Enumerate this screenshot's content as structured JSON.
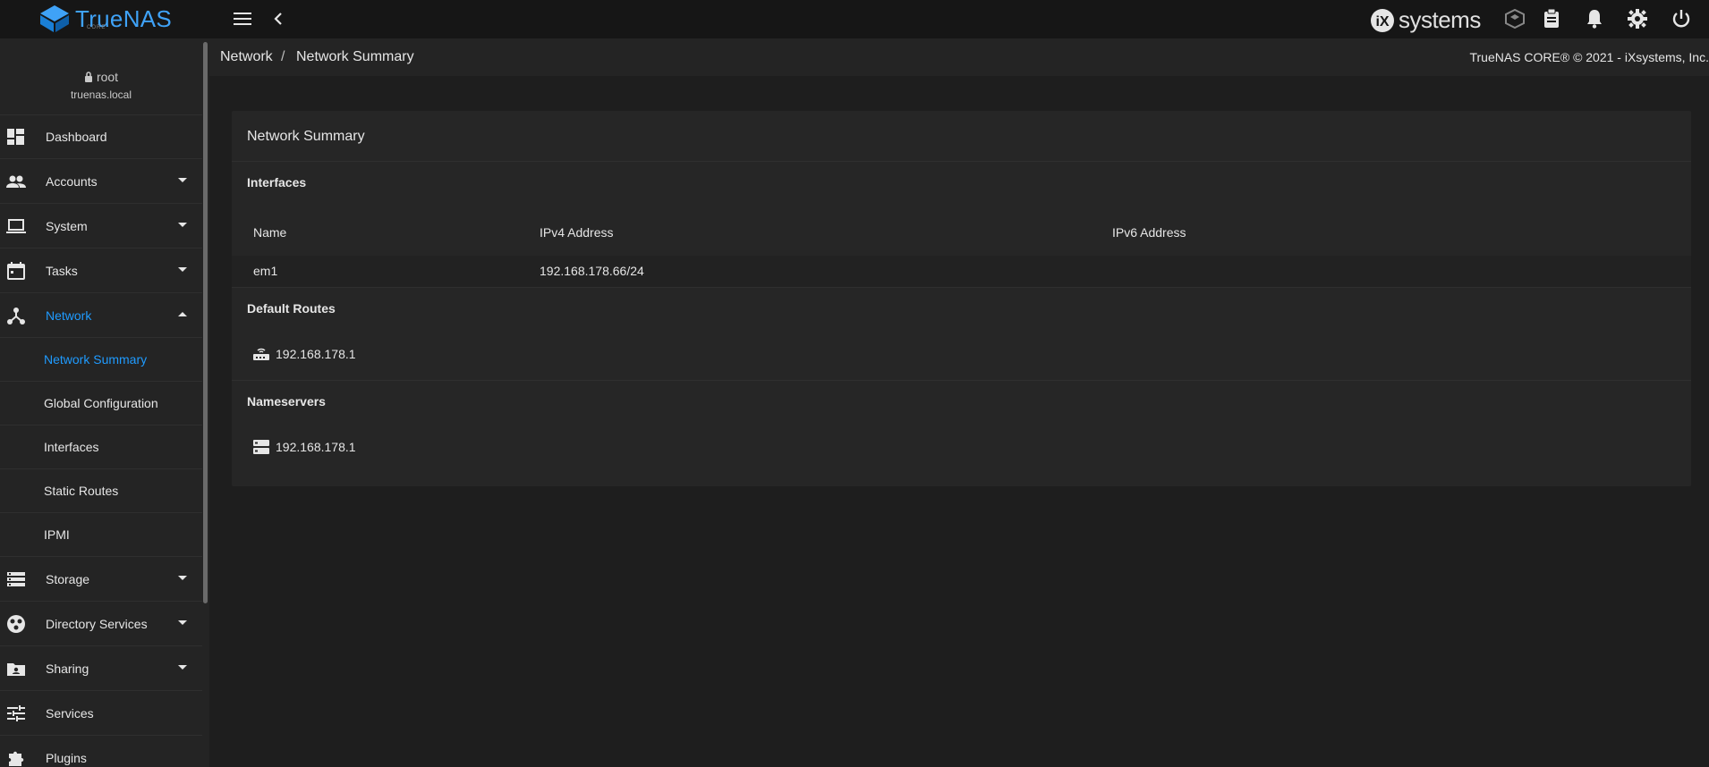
{
  "app": {
    "logo_text": "TrueNAS",
    "logo_sub": "CORE",
    "brand_right": "systems"
  },
  "user": {
    "name": "root",
    "host": "truenas.local"
  },
  "sidebar": {
    "items": [
      {
        "label": "Dashboard",
        "icon": "dashboard-icon",
        "caret": "none"
      },
      {
        "label": "Accounts",
        "icon": "accounts-icon",
        "caret": "down"
      },
      {
        "label": "System",
        "icon": "laptop-icon",
        "caret": "down"
      },
      {
        "label": "Tasks",
        "icon": "calendar-icon",
        "caret": "down"
      },
      {
        "label": "Network",
        "icon": "network-icon",
        "caret": "up"
      }
    ],
    "subitems": [
      {
        "label": "Network Summary"
      },
      {
        "label": "Global Configuration"
      },
      {
        "label": "Interfaces"
      },
      {
        "label": "Static Routes"
      },
      {
        "label": "IPMI"
      }
    ],
    "items2": [
      {
        "label": "Storage",
        "icon": "storage-icon",
        "caret": "down"
      },
      {
        "label": "Directory Services",
        "icon": "directory-icon",
        "caret": "down"
      },
      {
        "label": "Sharing",
        "icon": "sharing-icon",
        "caret": "down"
      },
      {
        "label": "Services",
        "icon": "tune-icon",
        "caret": "none"
      },
      {
        "label": "Plugins",
        "icon": "puzzle-icon",
        "caret": "none"
      }
    ]
  },
  "breadcrumb": {
    "parent": "Network",
    "separator": "/",
    "current": "Network Summary"
  },
  "copyright": "TrueNAS CORE® © 2021 - iXsystems, Inc.",
  "card": {
    "title": "Network Summary",
    "interfaces": {
      "title": "Interfaces",
      "columns": [
        "Name",
        "IPv4 Address",
        "IPv6 Address"
      ],
      "rows": [
        {
          "name": "em1",
          "ipv4": "192.168.178.66/24",
          "ipv6": ""
        }
      ]
    },
    "default_routes": {
      "title": "Default Routes",
      "entries": [
        "192.168.178.1"
      ]
    },
    "nameservers": {
      "title": "Nameservers",
      "entries": [
        "192.168.178.1"
      ]
    }
  },
  "colors": {
    "accent": "#1f9bff",
    "logo": "#3fa2f7",
    "background": "#1e1e1e",
    "panel": "#242424"
  }
}
